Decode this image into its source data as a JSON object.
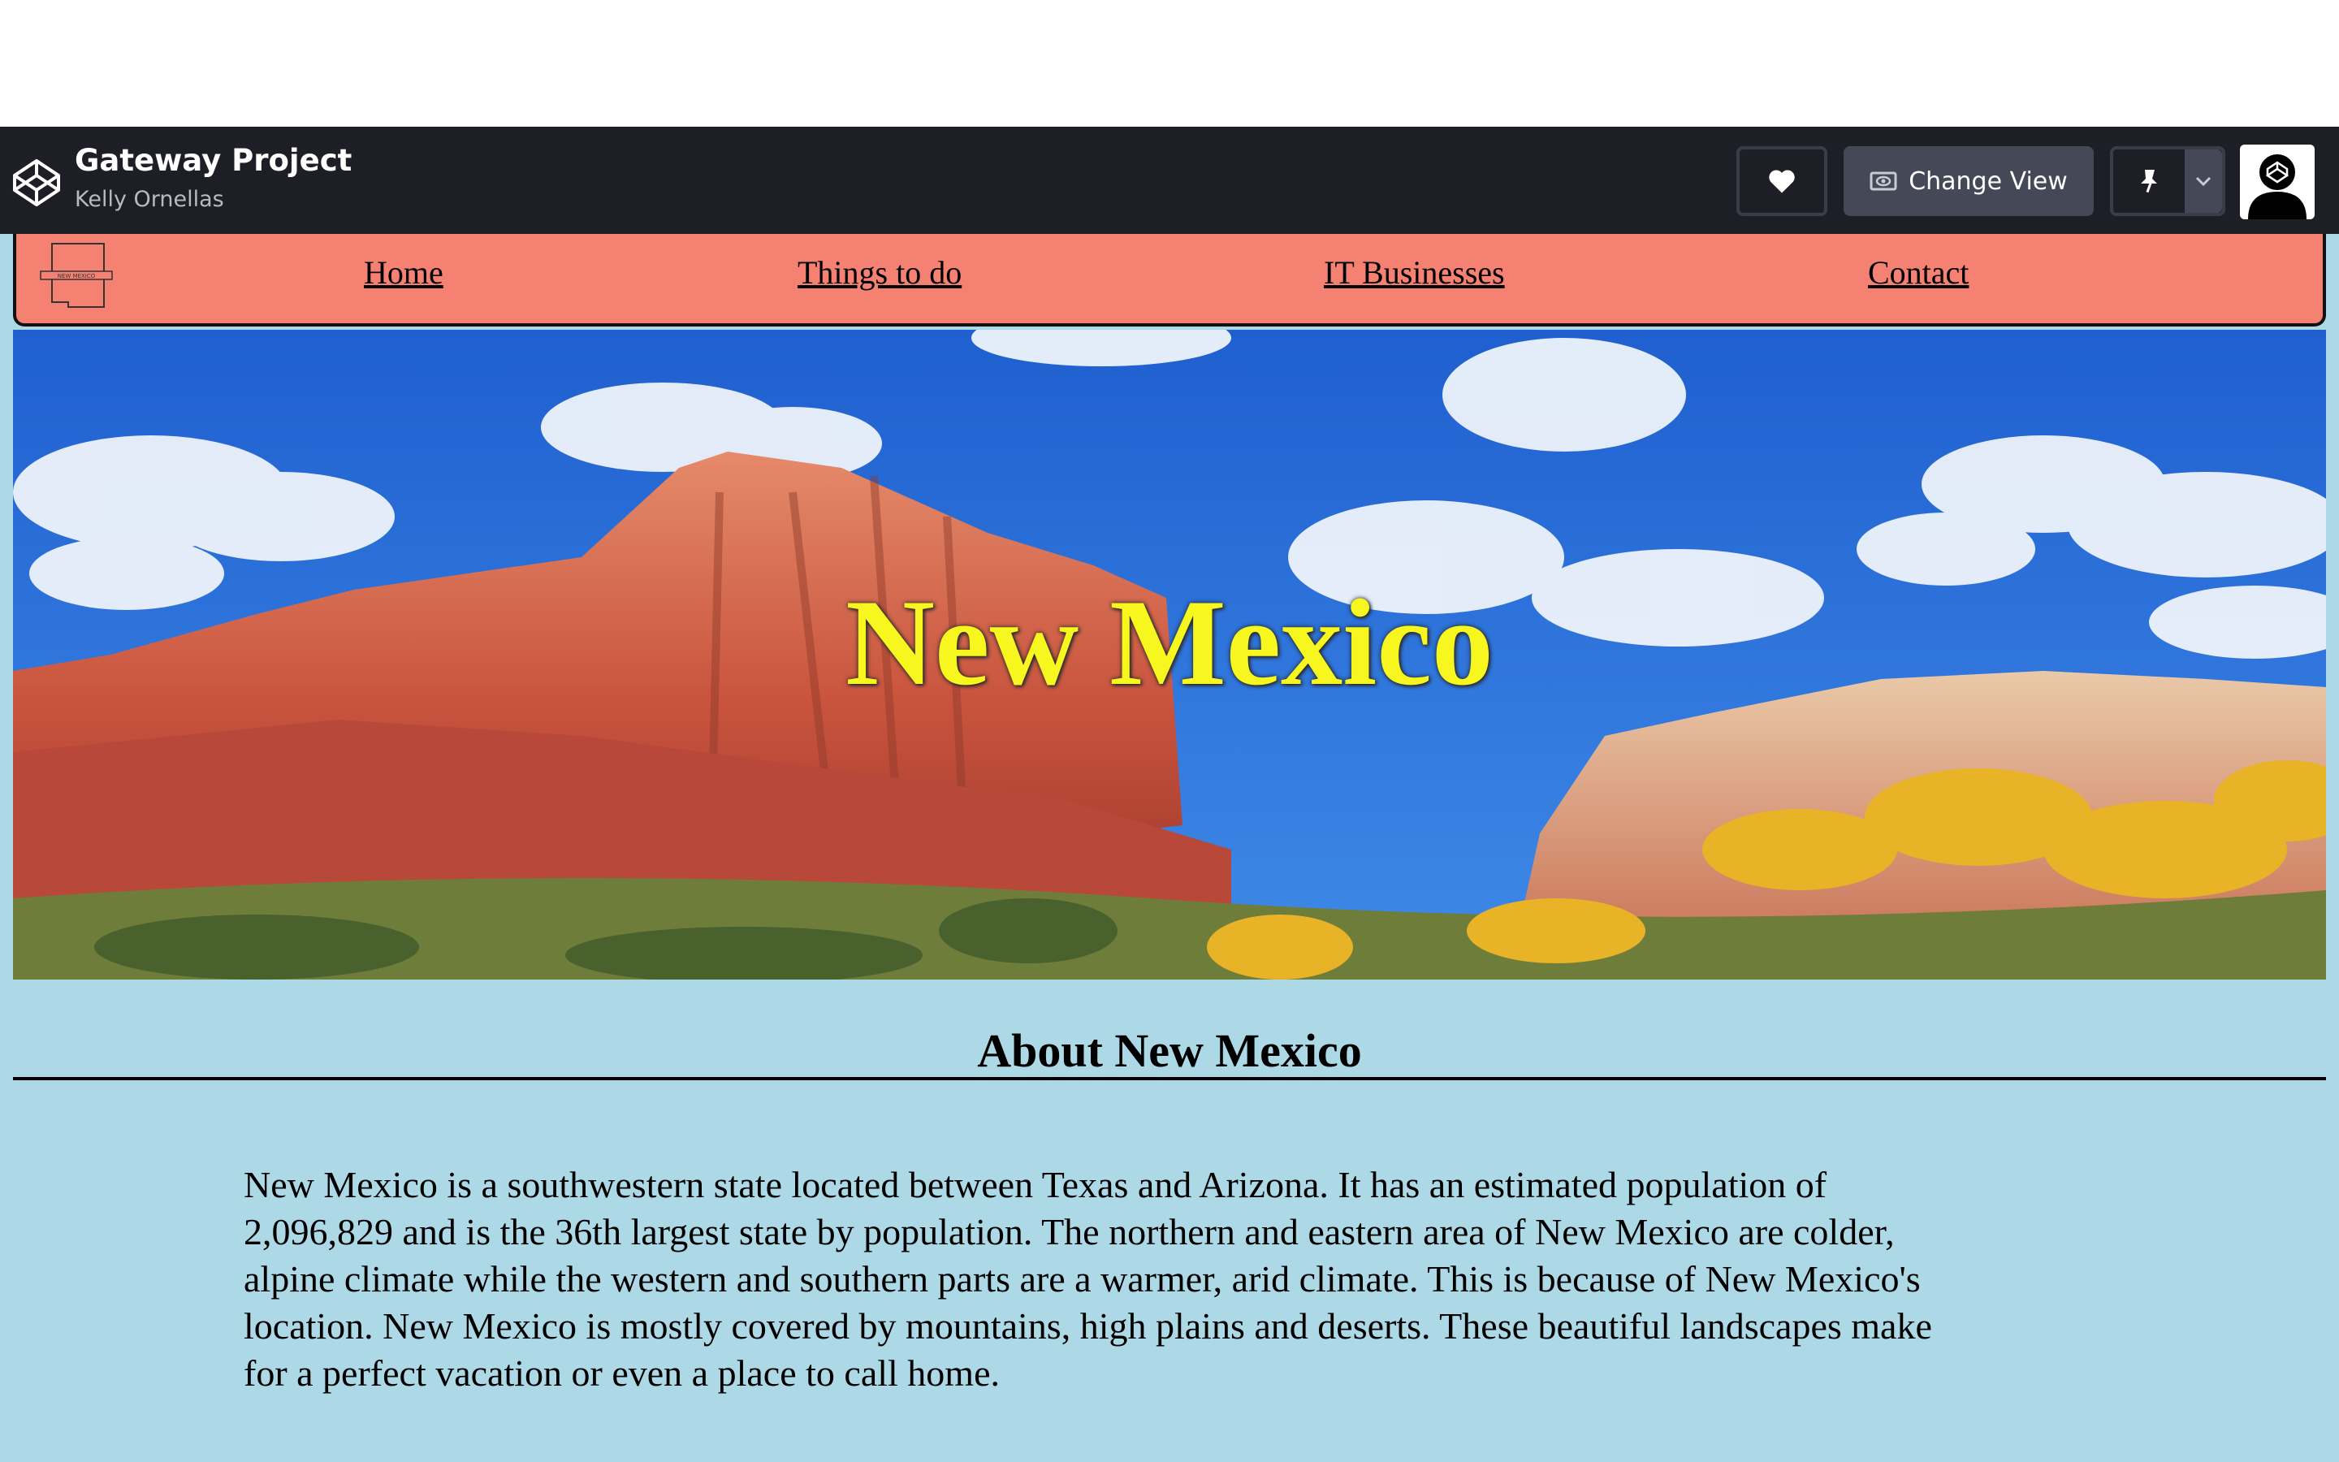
{
  "codepen": {
    "project_title": "Gateway Project",
    "author": "Kelly Ornellas",
    "change_view_label": "Change View",
    "icons": [
      "codepen-logo-icon",
      "heart-icon",
      "eye-icon",
      "pin-icon",
      "chevron-down-icon",
      "avatar-icon"
    ]
  },
  "nav": {
    "logo_text": "NEW MEXICO",
    "links": [
      {
        "label": "Home"
      },
      {
        "label": "Things to do"
      },
      {
        "label": "IT Businesses"
      },
      {
        "label": "Contact"
      }
    ]
  },
  "hero": {
    "title": "New Mexico"
  },
  "about": {
    "heading": "About New Mexico",
    "lines": [
      "New Mexico is a southwestern state located between Texas and Arizona. It has an estimated population of",
      "2,096,829 and is the 36th largest state by population. The northern and eastern area of New Mexico are colder,",
      "alpine climate while the western and southern parts are a warmer, arid climate. This is because of New Mexico's",
      "location. New Mexico is mostly covered by mountains, high plains and deserts. These beautiful landscapes make",
      "for a perfect vacation or even a place to call home."
    ]
  },
  "colors": {
    "codepen_bar": "#1e1f26",
    "nav_background": "#f58172",
    "page_background": "#add8e6",
    "hero_title": "#f7f71f"
  }
}
